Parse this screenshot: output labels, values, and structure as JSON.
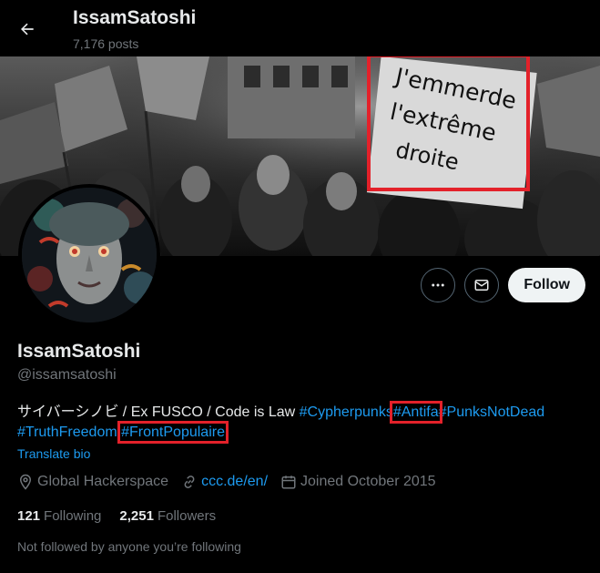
{
  "topbar": {
    "name": "IssamSatoshi",
    "posts": "7,176 posts"
  },
  "banner": {
    "sign_lines": [
      "J'emmerde",
      "l'extrême",
      "droite"
    ]
  },
  "actions": {
    "follow_label": "Follow"
  },
  "profile": {
    "display_name": "IssamSatoshi",
    "handle": "@issamsatoshi"
  },
  "bio": {
    "text": "サイバーシノビ / Ex FUSCO / Code is Law",
    "tags": [
      "#Cypherpunks",
      "#Antifa",
      "#PunksNotDead",
      "#TruthFreedom",
      "#FrontPopulaire"
    ],
    "translate_label": "Translate bio"
  },
  "meta": {
    "location": "Global Hackerspace",
    "website": "ccc.de/en/",
    "joined": "Joined October 2015"
  },
  "stats": {
    "following_count": "121",
    "following_label": "Following",
    "followers_count": "2,251",
    "followers_label": "Followers"
  },
  "not_followed": "Not followed by anyone you’re following",
  "colors": {
    "link": "#1d9bf0",
    "highlight_box": "#e3212a"
  }
}
